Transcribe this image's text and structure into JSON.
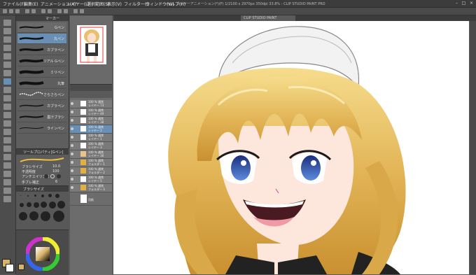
{
  "menu": {
    "items": [
      "ファイル(F)",
      "編集(E)",
      "アニメーション(A)",
      "レイヤー(L)",
      "選択範囲(S)",
      "表示(V)",
      "フィルター(I)",
      "ウィンドウ(W)",
      "ヘルプ(H)"
    ]
  },
  "window": {
    "title": "レイヤーアニメーション(*)(F) 1/2100 x 2970px 350dpi 33.8% - CLIP STUDIO PAINT PRO",
    "tab_label": "CLIP STUDIO PAINT"
  },
  "subtool": {
    "header": "マーカー",
    "brushes": [
      "Gペン",
      "丸ペン",
      "カブラペン",
      "リアル Gペン",
      "ミリペン",
      "丸筆",
      "さらさらペン",
      "カブラペン",
      "墨汁ブラシ",
      "ラインペン"
    ]
  },
  "tool_property": {
    "header": "ツールプロパティ[Gペン]",
    "brush_size_label": "ブラシサイズ",
    "brush_size_value": "10.0",
    "opacity_label": "不透明度",
    "opacity_value": "100",
    "antialias_label": "アンチエイリアス",
    "stabilization_label": "手ブレ補正",
    "stabilization_value": "6"
  },
  "brush_size_panel": {
    "header": "ブラシサイズ"
  },
  "layers": [
    {
      "name": "レイヤー 73",
      "blend": "100 % 通常",
      "selected": false
    },
    {
      "name": "レイヤー 49",
      "blend": "100 % 通常",
      "selected": false
    },
    {
      "name": "レイヤー 38",
      "blend": "100 % 通常",
      "selected": false
    },
    {
      "name": "レイヤー 2",
      "blend": "100 % 通常",
      "selected": true
    },
    {
      "name": "レイヤー 1",
      "blend": "100 % 通常",
      "selected": false
    },
    {
      "name": "レイヤー 3",
      "blend": "100 % 通常",
      "selected": false
    },
    {
      "name": "レイヤー 36",
      "blend": "100 % 通常",
      "selected": false
    },
    {
      "name": "フォルダー 1",
      "blend": "100 % 通常",
      "selected": false
    },
    {
      "name": "フォルダー 2",
      "blend": "100 % 通常",
      "selected": false
    },
    {
      "name": "レイヤー 5",
      "blend": "100 % 通常",
      "selected": false
    },
    {
      "name": "フォルダー 3",
      "blend": "100 % 通常",
      "selected": false
    },
    {
      "name": "用紙",
      "blend": "",
      "selected": false
    }
  ],
  "colors": {
    "accent": "#6a8fb5",
    "main_color": "#d8b36a",
    "sub_color": "#ffffff"
  }
}
